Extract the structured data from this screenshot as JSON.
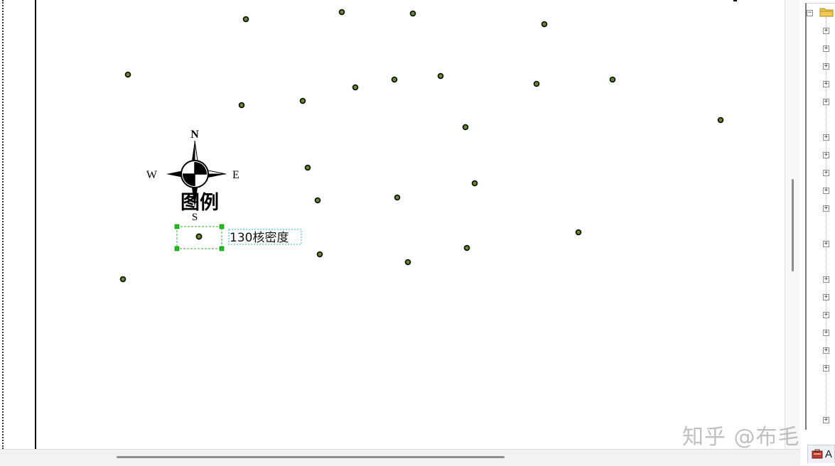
{
  "map": {
    "legend_title": "图例",
    "legend_label": "130核密度",
    "compass": {
      "north": "N",
      "south": "S",
      "east": "E",
      "west": "W"
    },
    "point_color": "#6b8e23"
  },
  "toc": {
    "expander_symbol": "+",
    "collapse_symbol": "−",
    "bottom_tab_label": "A"
  },
  "watermark": "知乎 @布毛"
}
